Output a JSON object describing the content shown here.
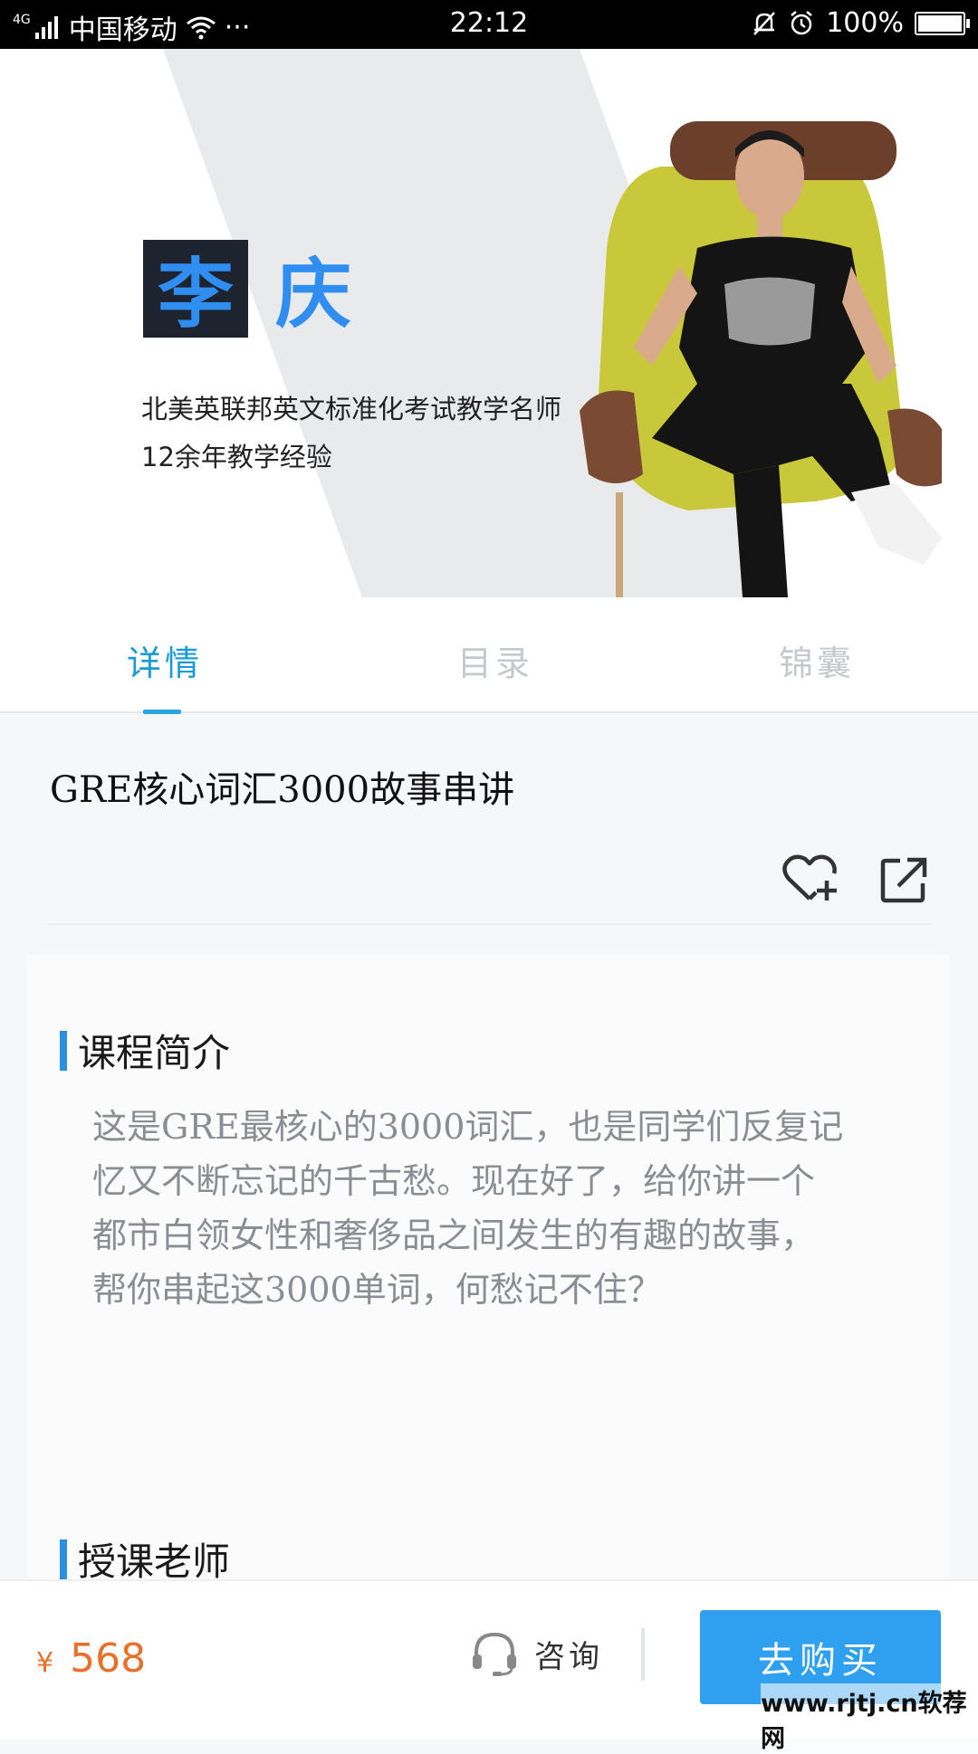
{
  "status_bar": {
    "signal_tag": "4G",
    "carrier": "中国移动",
    "dots": "···",
    "time": "22:12",
    "battery": "100%",
    "battery_level": 1.0
  },
  "banner": {
    "name_char1": "李",
    "name_char2": "庆",
    "line1": "北美英联邦英文标准化考试教学名师",
    "line2": "12余年教学经验"
  },
  "tabs": [
    {
      "label": "详情",
      "active": true
    },
    {
      "label": "目录",
      "active": false
    },
    {
      "label": "锦囊",
      "active": false
    }
  ],
  "course": {
    "title": "GRE核心词汇3000故事串讲"
  },
  "intro": {
    "heading": "课程简介",
    "lines": [
      "这是GRE最核心的3000词汇，也是同学们反复记",
      "忆又不断忘记的千古愁。现在好了，给你讲一个",
      "都市白领女性和奢侈品之间发生的有趣的故事，",
      "帮你串起这3000单词，何愁记不住？"
    ]
  },
  "teacher_section": {
    "heading": "授课老师"
  },
  "bottom": {
    "currency": "¥",
    "price": "568",
    "consult_label": "咨询",
    "buy_label": "去购买"
  },
  "watermark": "www.rjtj.cn软荐网",
  "colors": {
    "accent": "#2f9ff0",
    "tab_active": "#1a9ad6",
    "price": "#e8702a"
  },
  "icons": [
    "signal-icon",
    "wifi-icon",
    "bell-mute-icon",
    "alarm-icon",
    "battery-icon",
    "heart-plus-icon",
    "share-icon",
    "headset-icon"
  ]
}
